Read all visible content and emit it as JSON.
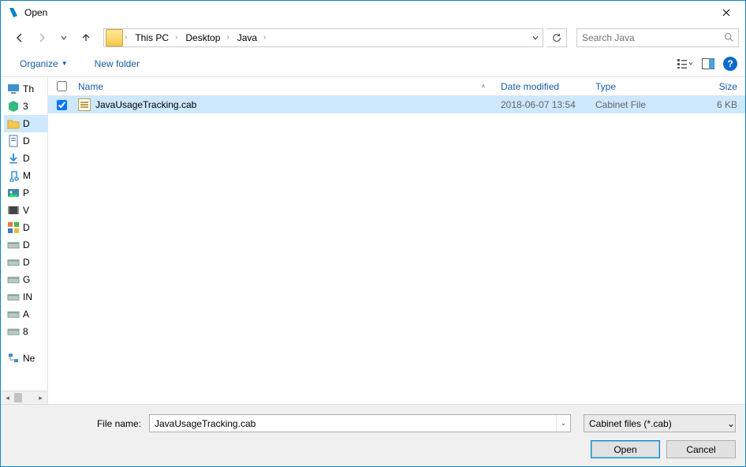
{
  "window": {
    "title": "Open"
  },
  "nav": {
    "crumbs": [
      "This PC",
      "Desktop",
      "Java"
    ]
  },
  "search": {
    "placeholder": "Search Java"
  },
  "toolbar": {
    "organize": "Organize",
    "new_folder": "New folder"
  },
  "sidebar_items": [
    {
      "label": "Th",
      "icon": "monitor",
      "selected": false
    },
    {
      "label": "3",
      "icon": "cube",
      "selected": false
    },
    {
      "label": "D",
      "icon": "folder",
      "selected": true
    },
    {
      "label": "D",
      "icon": "doc",
      "selected": false
    },
    {
      "label": "D",
      "icon": "download",
      "selected": false
    },
    {
      "label": "M",
      "icon": "music",
      "selected": false
    },
    {
      "label": "P",
      "icon": "picture",
      "selected": false
    },
    {
      "label": "V",
      "icon": "video",
      "selected": false
    },
    {
      "label": "D",
      "icon": "apps",
      "selected": false
    },
    {
      "label": "D",
      "icon": "drive",
      "selected": false
    },
    {
      "label": "D",
      "icon": "drive",
      "selected": false
    },
    {
      "label": "G",
      "icon": "drive",
      "selected": false
    },
    {
      "label": "IN",
      "icon": "drive",
      "selected": false
    },
    {
      "label": "A",
      "icon": "drive",
      "selected": false
    },
    {
      "label": "8",
      "icon": "drive",
      "selected": false
    }
  ],
  "sidebar_footer": {
    "label": "Ne",
    "icon": "network"
  },
  "columns": {
    "name": "Name",
    "date": "Date modified",
    "type": "Type",
    "size": "Size"
  },
  "files": [
    {
      "name": "JavaUsageTracking.cab",
      "date": "2018-06-07 13:54",
      "type": "Cabinet File",
      "size": "6 KB",
      "checked": true,
      "selected": true
    }
  ],
  "footer": {
    "filename_label": "File name:",
    "filename_value": "JavaUsageTracking.cab",
    "filter": "Cabinet files (*.cab)",
    "open": "Open",
    "cancel": "Cancel"
  }
}
